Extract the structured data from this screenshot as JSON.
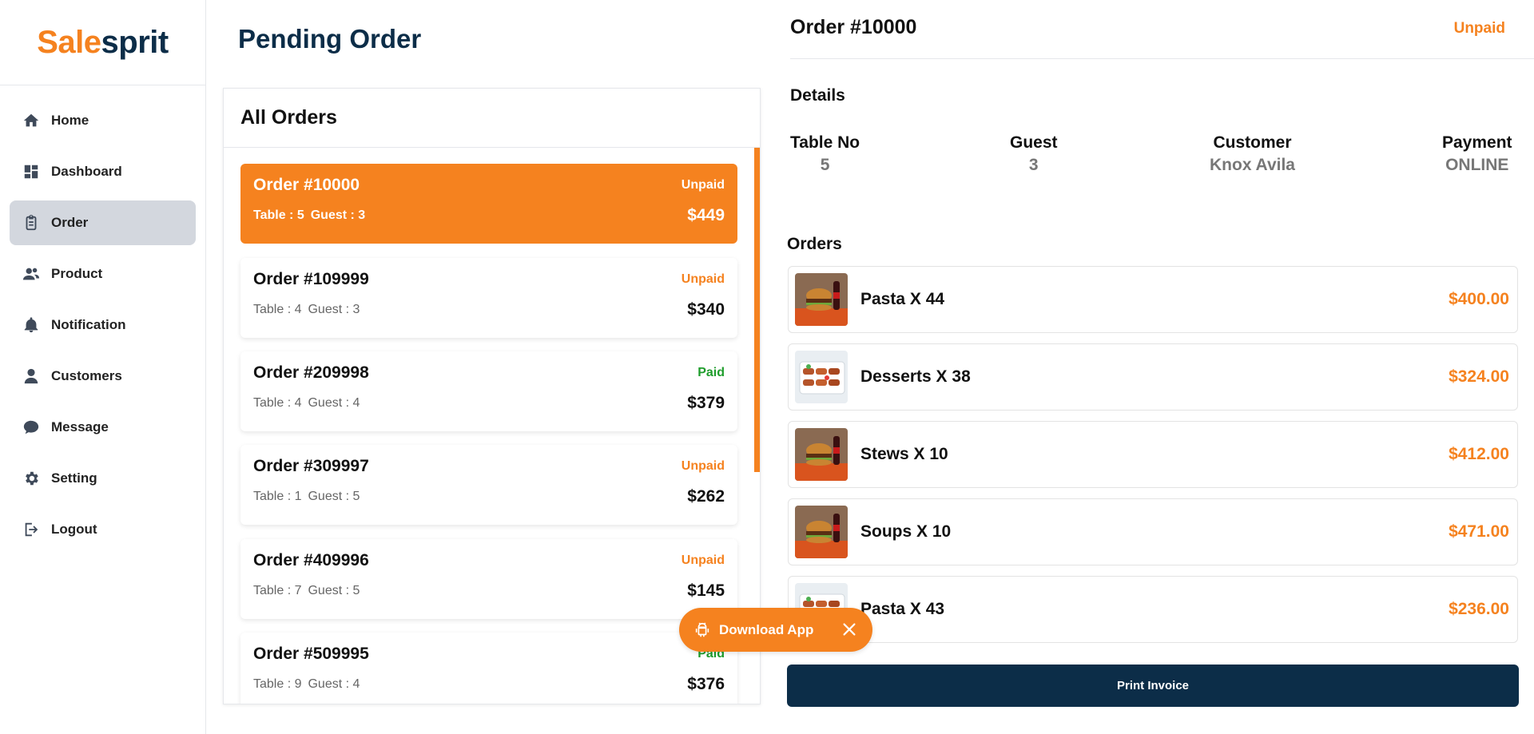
{
  "brand": {
    "part1": "Sale",
    "part2": "sprit"
  },
  "sidebar": {
    "items": [
      {
        "label": "Home",
        "icon": "home-icon",
        "active": false
      },
      {
        "label": "Dashboard",
        "icon": "dashboard-icon",
        "active": false
      },
      {
        "label": "Order",
        "icon": "clipboard-icon",
        "active": true
      },
      {
        "label": "Product",
        "icon": "users-icon",
        "active": false
      },
      {
        "label": "Notification",
        "icon": "bell-icon",
        "active": false
      },
      {
        "label": "Customers",
        "icon": "user-icon",
        "active": false
      },
      {
        "label": "Message",
        "icon": "chat-icon",
        "active": false
      },
      {
        "label": "Setting",
        "icon": "gear-icon",
        "active": false
      },
      {
        "label": "Logout",
        "icon": "logout-icon",
        "active": false
      }
    ]
  },
  "page": {
    "title": "Pending Order"
  },
  "orders_panel": {
    "title": "All Orders",
    "orders": [
      {
        "title": "Order #10000",
        "status": "Unpaid",
        "table": "Table : 5",
        "guest": "Guest : 3",
        "price": "$449",
        "selected": true
      },
      {
        "title": "Order #109999",
        "status": "Unpaid",
        "table": "Table : 4",
        "guest": "Guest : 3",
        "price": "$340",
        "selected": false
      },
      {
        "title": "Order #209998",
        "status": "Paid",
        "table": "Table : 4",
        "guest": "Guest : 4",
        "price": "$379",
        "selected": false
      },
      {
        "title": "Order #309997",
        "status": "Unpaid",
        "table": "Table : 1",
        "guest": "Guest : 5",
        "price": "$262",
        "selected": false
      },
      {
        "title": "Order #409996",
        "status": "Unpaid",
        "table": "Table : 7",
        "guest": "Guest : 5",
        "price": "$145",
        "selected": false
      },
      {
        "title": "Order #509995",
        "status": "Paid",
        "table": "Table : 9",
        "guest": "Guest : 4",
        "price": "$376",
        "selected": false
      }
    ]
  },
  "detail": {
    "title": "Order #10000",
    "status": "Unpaid",
    "details_label": "Details",
    "info": [
      {
        "key": "Table No",
        "value": "5"
      },
      {
        "key": "Guest",
        "value": "3"
      },
      {
        "key": "Customer",
        "value": "Knox Avila"
      },
      {
        "key": "Payment",
        "value": "ONLINE"
      }
    ],
    "orders_label": "Orders",
    "items": [
      {
        "name": "Pasta X 44",
        "price": "$400.00",
        "thumb": "burger"
      },
      {
        "name": "Desserts X 38",
        "price": "$324.00",
        "thumb": "skewers"
      },
      {
        "name": "Stews X 10",
        "price": "$412.00",
        "thumb": "burger"
      },
      {
        "name": "Soups X 10",
        "price": "$471.00",
        "thumb": "burger"
      },
      {
        "name": "Pasta X 43",
        "price": "$236.00",
        "thumb": "skewers"
      }
    ],
    "print_label": "Print Invoice"
  },
  "download": {
    "label": "Download App"
  },
  "colors": {
    "accent": "#f5821f",
    "navy": "#0c2d48",
    "paid": "#1f9d2c"
  }
}
